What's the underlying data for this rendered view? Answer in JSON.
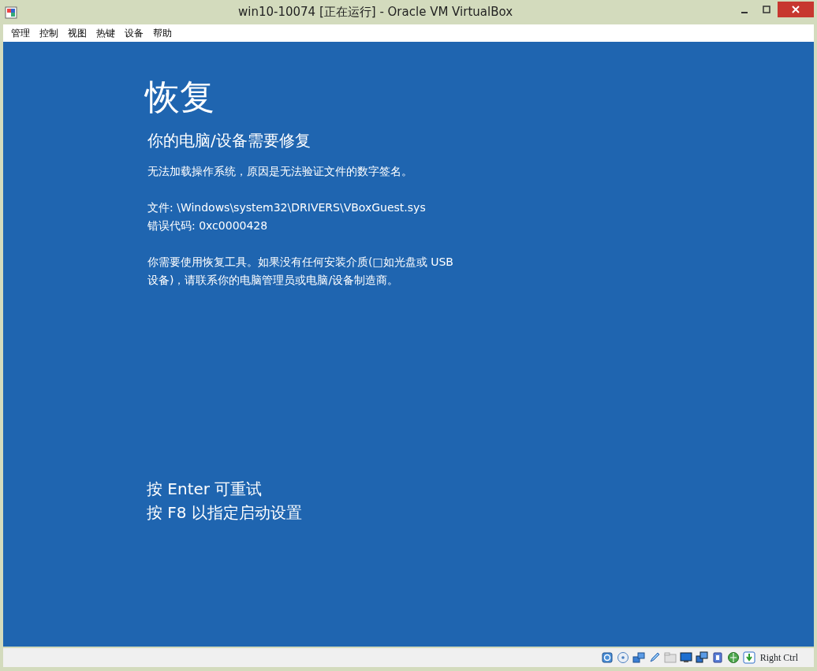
{
  "window": {
    "title": "win10-10074 [正在运行] - Oracle VM VirtualBox"
  },
  "menu": [
    "管理",
    "控制",
    "视图",
    "热键",
    "设备",
    "帮助"
  ],
  "screen": {
    "heading": "恢复",
    "subheading": "你的电脑/设备需要修复",
    "paragraphs": [
      {
        "lines": [
          "无法加载操作系统，原因是无法验证文件的数字签名。"
        ]
      },
      {
        "lines": [
          "文件: \\Windows\\system32\\DRIVERS\\VBoxGuest.sys",
          "错误代码: 0xc0000428"
        ]
      },
      {
        "lines": [
          "你需要使用恢复工具。如果没有任何安装介质(□如光盘或 USB",
          "设备)，请联系你的电脑管理员或电脑/设备制造商。"
        ]
      }
    ],
    "prompts": [
      "按 Enter 可重试",
      "按 F8 以指定启动设置"
    ]
  },
  "status_bar": {
    "host_key": "Right Ctrl"
  }
}
